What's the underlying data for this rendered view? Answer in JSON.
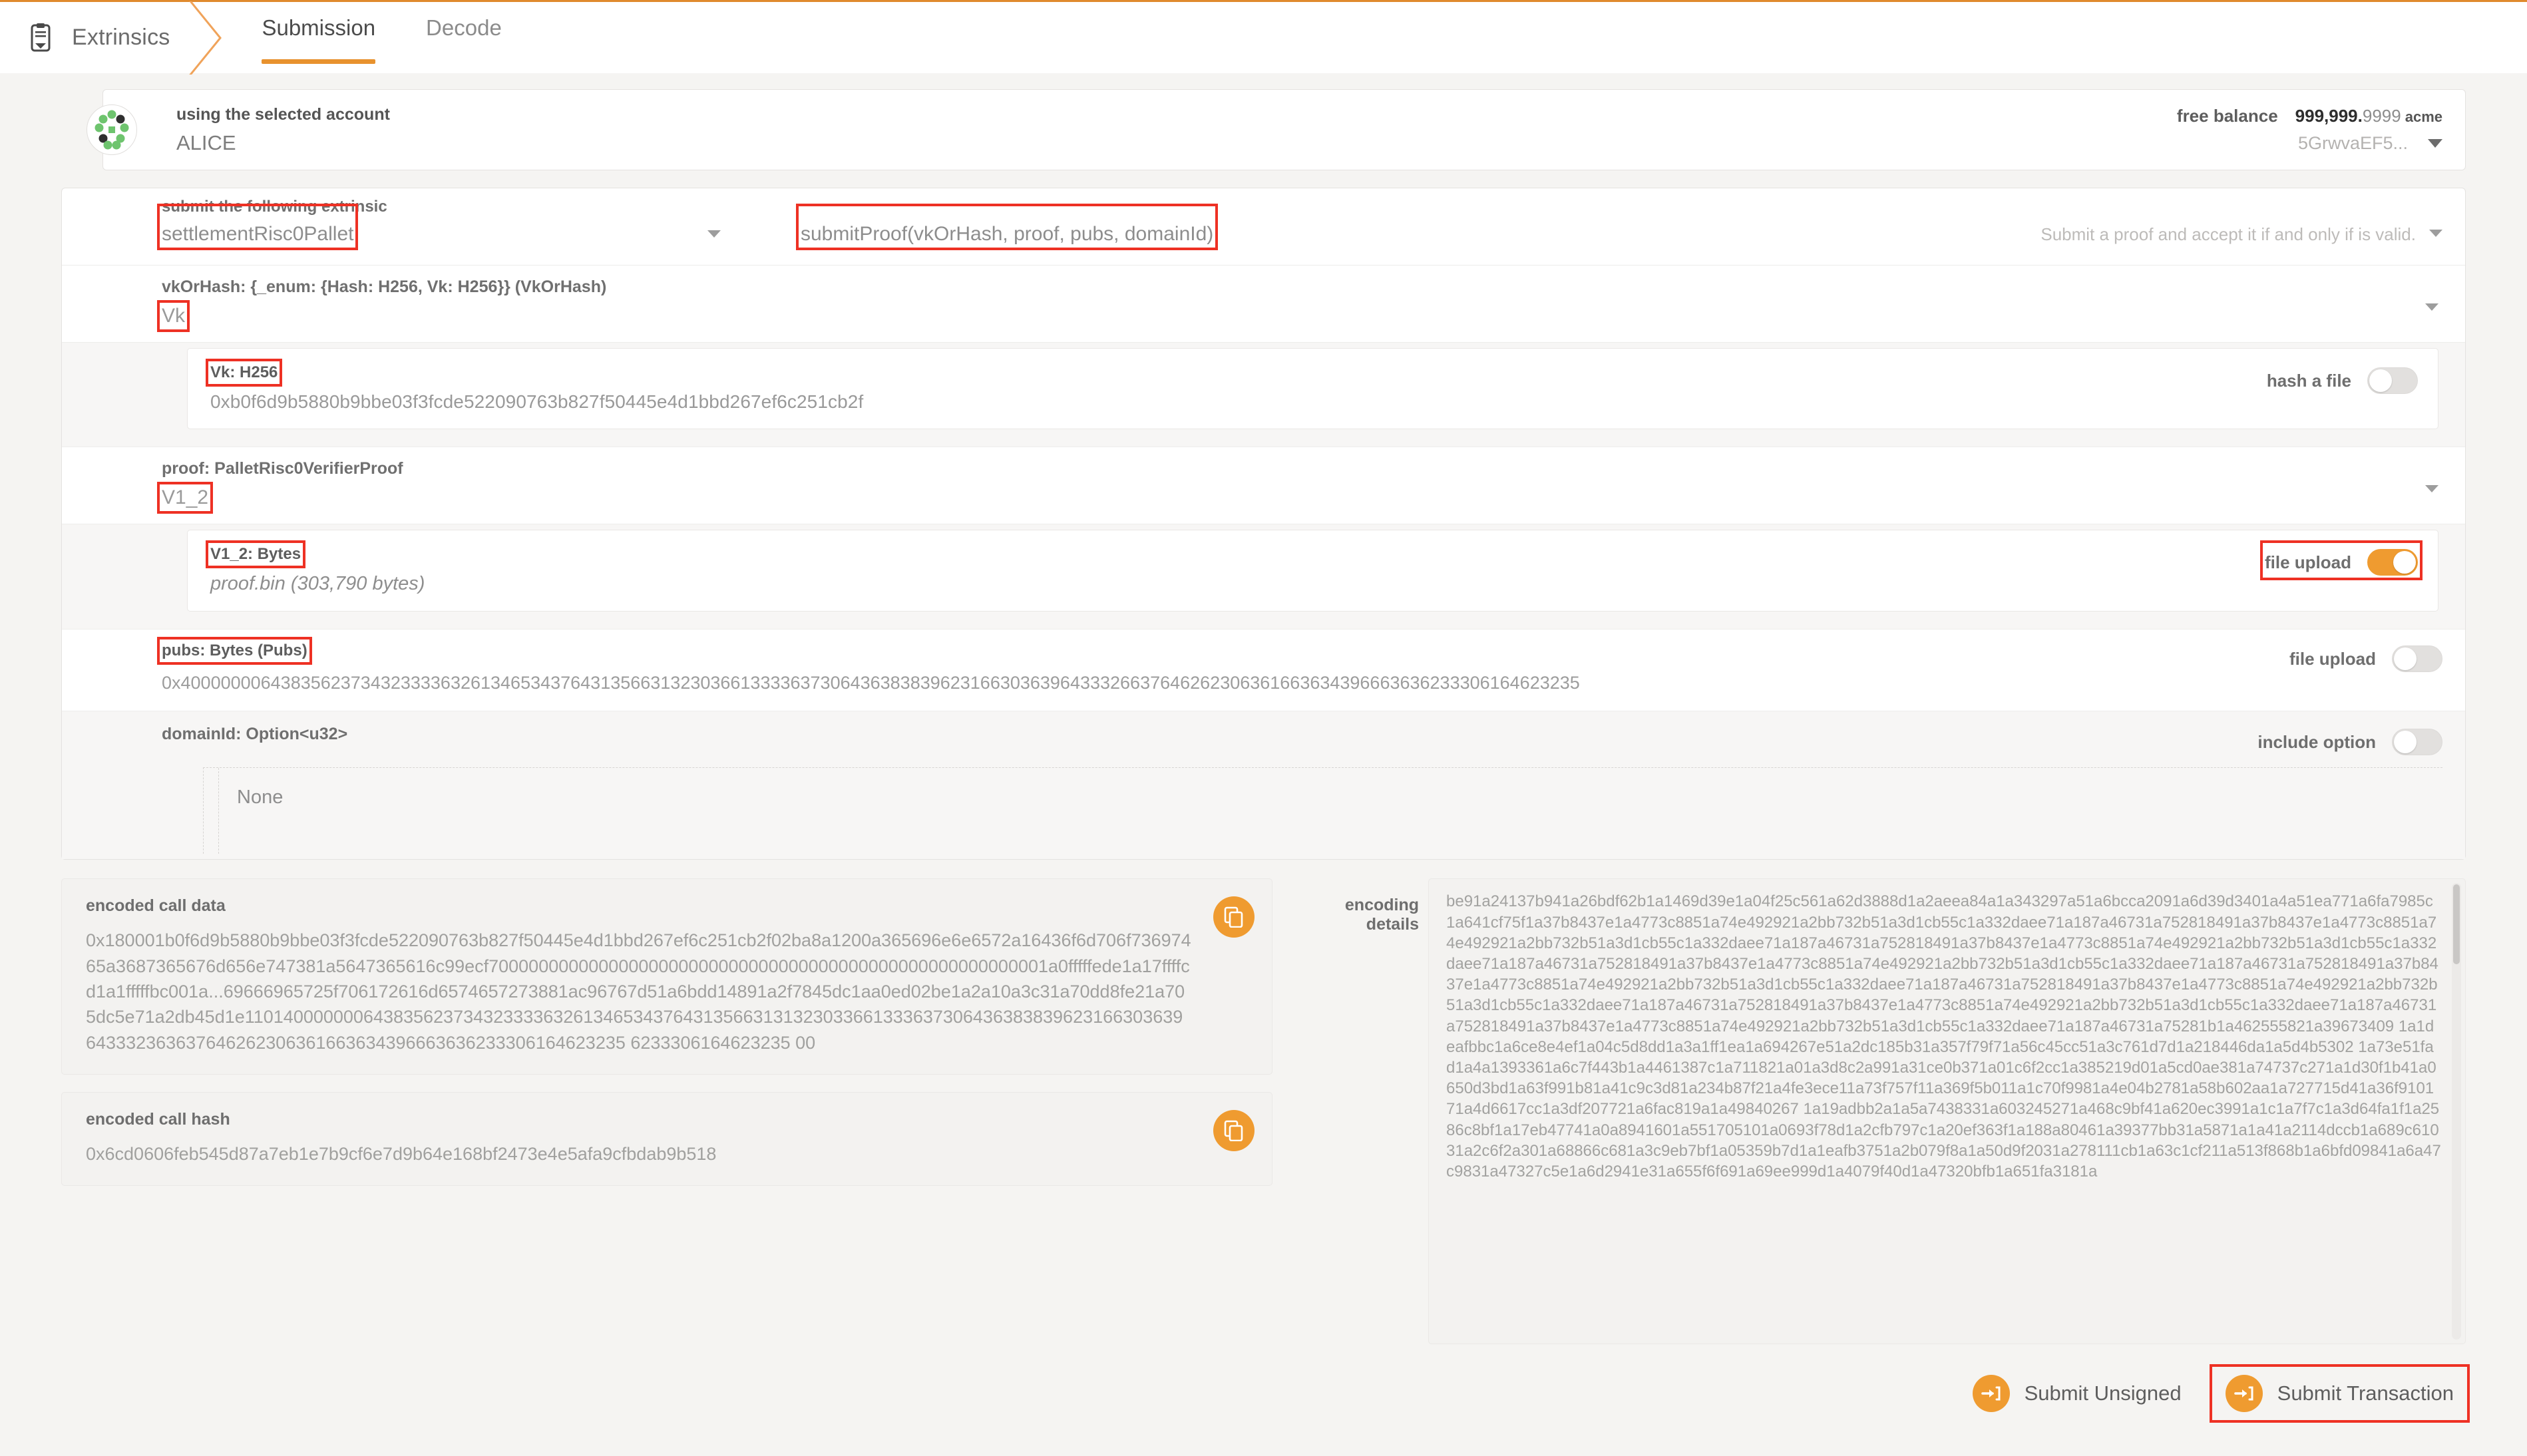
{
  "header": {
    "breadcrumb": "Extrinsics",
    "breadcrumb_icon": "clipboard-icon",
    "tabs": [
      {
        "label": "Submission",
        "active": true
      },
      {
        "label": "Decode",
        "active": false
      }
    ]
  },
  "account": {
    "title": "using the selected account",
    "name": "ALICE",
    "balance_label": "free balance",
    "balance_int": "999,999.",
    "balance_frac": "9999",
    "balance_unit": "acme",
    "address": "5GrwvaEF5...",
    "caret_icon": "chevron-down-icon"
  },
  "extrinsic": {
    "label": "submit the following extrinsic",
    "pallet": "settlementRisc0Pallet",
    "method": "submitProof(vkOrHash, proof, pubs, domainId)",
    "hint": "Submit a proof and accept it if and only if is valid."
  },
  "fields": {
    "vkOrHash": {
      "label": "vkOrHash: {_enum: {Hash: H256, Vk: H256}} (VkOrHash)",
      "value": "Vk",
      "child_label": "Vk: H256",
      "child_value": "0xb0f6d9b5880b9bbe03f3fcde522090763b827f50445e4d1bbd267ef6c251cb2f",
      "toggle_label": "hash a file",
      "toggle_on": false
    },
    "proof": {
      "label": "proof: PalletRisc0VerifierProof",
      "value": "V1_2",
      "child_label": "V1_2: Bytes",
      "child_value": "proof.bin (303,790 bytes)",
      "toggle_label": "file upload",
      "toggle_on": true
    },
    "pubs": {
      "label": "pubs: Bytes (Pubs)",
      "value": "0x40000000643835623734323333632613465343764313566313230366133336373064363838396231663036396433326637646262306361663634396663636233306164623235",
      "toggle_label": "file upload",
      "toggle_on": false
    },
    "domainId": {
      "label": "domainId: Option<u32>",
      "value": "None",
      "toggle_label": "include option",
      "toggle_on": false
    }
  },
  "encoded": {
    "call_data_label": "encoded call data",
    "call_data": "0x180001b0f6d9b5880b9bbe03f3fcde522090763b827f50445e4d1bbd267ef6c251cb2f02ba8a1200a365696e6e6572a16436f6d706f73697465a3687365676d656e747381a5647365616c99ecf70000000000000000000000000000000000000000000000000000001a0fffffede1a17ffffcd1a1fffffbc001a...69666965725f706172616d6574657273881ac96767d51a6bdd14891a2f7845dc1aa0ed02be1a2a10a3c31a70dd8fe21a705dc5e71a2db45d1e1101400000006438356237343233336326134653437643135663131323033661333637306436383839623166303639643332363637646262306361663634396663636233306164623235 6233306164623235 00",
    "call_hash_label": "encoded call hash",
    "call_hash": "0x6cd0606feb545d87a7eb1e7b9cf6e7d9b64e168bf2473e4e5afa9cfbdab9b518",
    "copy_icon": "copy-icon"
  },
  "encoding_details": {
    "label": "encoding details",
    "text": "be91a24137b941a26bdf62b1a1469d39e1a04f25c561a62d3888d1a2aeea84a1a343297a51a6bcca2091a6d39d3401a4a51ea771a6fa7985c1a641cf75f1a37b8437e1a4773c8851a74e492921a2bb732b51a3d1cb55c1a332daee71a187a46731a752818491a37b8437e1a4773c8851a74e492921a2bb732b51a3d1cb55c1a332daee71a187a46731a752818491a37b8437e1a4773c8851a74e492921a2bb732b51a3d1cb55c1a332daee71a187a46731a752818491a37b8437e1a4773c8851a74e492921a2bb732b51a3d1cb55c1a332daee71a187a46731a752818491a37b8437e1a4773c8851a74e492921a2bb732b51a3d1cb55c1a332daee71a187a46731a752818491a37b8437e1a4773c8851a74e492921a2bb732b51a3d1cb55c1a332daee71a187a46731a752818491a37b8437e1a4773c8851a74e492921a2bb732b51a3d1cb55c1a332daee71a187a46731a752818491a37b8437e1a4773c8851a74e492921a2bb732b51a3d1cb55c1a332daee71a187a46731a75281b1a462555821a39673409 1a1deafbbc1a6ce8e4ef1a04c5d8dd1a3a1ff1ea1a694267e51a2dc185b31a357f79f71a56c45cc51a3c761d7d1a218446da1a5d4b5302 1a73e51fad1a4a1393361a6c7f443b1a4461387c1a711821a01a3d8c2a991a31ce0b371a01c6f2cc1a385219d01a5cd0ae381a74737c271a1d30f1b41a0650d3bd1a63f991b81a41c9c3d81a234b87f21a4fe3ece11a73f757f11a369f5b011a1c70f9981a4e04b2781a58b602aa1a727715d41a36f910171a4d6617cc1a3df207721a6fac819a1a49840267 1a19adbb2a1a5a7438331a603245271a468c9bf41a620ec3991a1c1a7f7c1a3d64fa1f1a2586c8bf1a17eb47741a0a8941601a551705101a0693f78d1a2cfb797c1a20ef363f1a188a80461a39377bb31a5871a1a41a2114dccb1a689c61031a2c6f2a301a68866c681a3c9eb7bf1a05359b7d1a1eafb3751a2b079f8a1a50d9f2031a278111cb1a63c1cf211a513f868b1a6bfd09841a6a47c9831a47327c5e1a6d2941e31a655f6f691a69ee999d1a4079f40d1a47320bfb1a651fa3181a",
    "scroll_position": 0.02
  },
  "buttons": {
    "submit_unsigned": "Submit Unsigned",
    "submit_transaction": "Submit Transaction",
    "icon": "arrow-right-into-bracket-icon"
  }
}
